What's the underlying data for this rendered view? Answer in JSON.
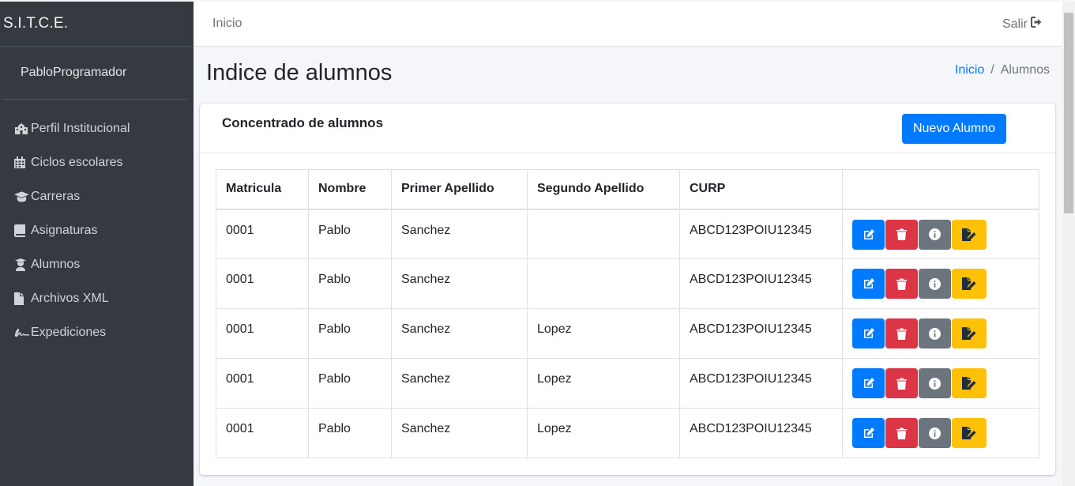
{
  "sidebar": {
    "brand": "S.I.T.C.E.",
    "user": "PabloProgramador",
    "items": [
      {
        "label": "Perfil Institucional",
        "icon": "school-icon"
      },
      {
        "label": "Ciclos escolares",
        "icon": "calendar-icon"
      },
      {
        "label": "Carreras",
        "icon": "graduation-cap-icon"
      },
      {
        "label": "Asignaturas",
        "icon": "book-icon"
      },
      {
        "label": "Alumnos",
        "icon": "user-graduate-icon"
      },
      {
        "label": "Archivos XML",
        "icon": "file-icon"
      },
      {
        "label": "Expediciones",
        "icon": "signature-icon"
      }
    ]
  },
  "topbar": {
    "home_label": "Inicio",
    "logout_label": "Salir"
  },
  "header": {
    "title": "Indice de alumnos",
    "breadcrumb": [
      "Inicio",
      "Alumnos"
    ]
  },
  "card": {
    "title": "Concentrado de alumnos",
    "new_button": "Nuevo Alumno"
  },
  "table": {
    "columns": [
      "Matricula",
      "Nombre",
      "Primer Apellido",
      "Segundo Apellido",
      "CURP",
      ""
    ],
    "rows": [
      {
        "matricula": "0001",
        "nombre": "Pablo",
        "primer_apellido": "Sanchez",
        "segundo_apellido": "",
        "curp": "ABCD123POIU12345"
      },
      {
        "matricula": "0001",
        "nombre": "Pablo",
        "primer_apellido": "Sanchez",
        "segundo_apellido": "",
        "curp": "ABCD123POIU12345"
      },
      {
        "matricula": "0001",
        "nombre": "Pablo",
        "primer_apellido": "Sanchez",
        "segundo_apellido": "Lopez",
        "curp": "ABCD123POIU12345"
      },
      {
        "matricula": "0001",
        "nombre": "Pablo",
        "primer_apellido": "Sanchez",
        "segundo_apellido": "Lopez",
        "curp": "ABCD123POIU12345"
      },
      {
        "matricula": "0001",
        "nombre": "Pablo",
        "primer_apellido": "Sanchez",
        "segundo_apellido": "Lopez",
        "curp": "ABCD123POIU12345"
      }
    ],
    "row_actions": [
      {
        "name": "edit-button",
        "icon": "edit-icon",
        "color": "#007bff"
      },
      {
        "name": "delete-button",
        "icon": "trash-icon",
        "color": "#dc3545"
      },
      {
        "name": "info-button",
        "icon": "info-icon",
        "color": "#6c757d"
      },
      {
        "name": "grades-button",
        "icon": "file-signature-icon",
        "color": "#ffc107"
      }
    ]
  },
  "colors": {
    "sidebar_bg": "#343a40",
    "primary": "#007bff",
    "danger": "#dc3545",
    "secondary": "#6c757d",
    "warning": "#ffc107"
  }
}
